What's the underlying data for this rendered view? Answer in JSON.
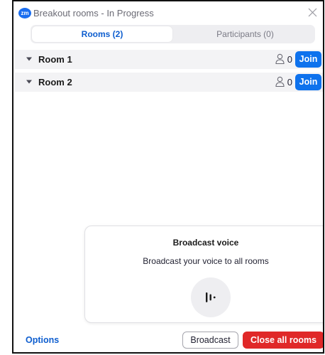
{
  "window": {
    "logo_text": "zm",
    "title": "Breakout rooms - In Progress",
    "close_icon": "close-icon"
  },
  "tabs": [
    {
      "label": "Rooms (2)",
      "selected": true
    },
    {
      "label": "Participants (0)",
      "selected": false
    }
  ],
  "rooms": [
    {
      "name": "Room 1",
      "count": "0",
      "join_label": "Join",
      "expand_icon": "caret-down-icon",
      "count_icon": "person-icon"
    },
    {
      "name": "Room 2",
      "count": "0",
      "join_label": "Join",
      "expand_icon": "caret-down-icon",
      "count_icon": "person-icon"
    }
  ],
  "broadcast_card": {
    "title": "Broadcast voice",
    "text": "Broadcast your voice to all rooms",
    "mic_icon": "voice-wave-icon"
  },
  "footer": {
    "options_label": "Options",
    "broadcast_label": "Broadcast",
    "close_all_label": "Close all rooms"
  },
  "colors": {
    "accent_blue": "#0e72ed",
    "danger_red": "#e02828",
    "logo_blue": "#1a6ef0"
  }
}
